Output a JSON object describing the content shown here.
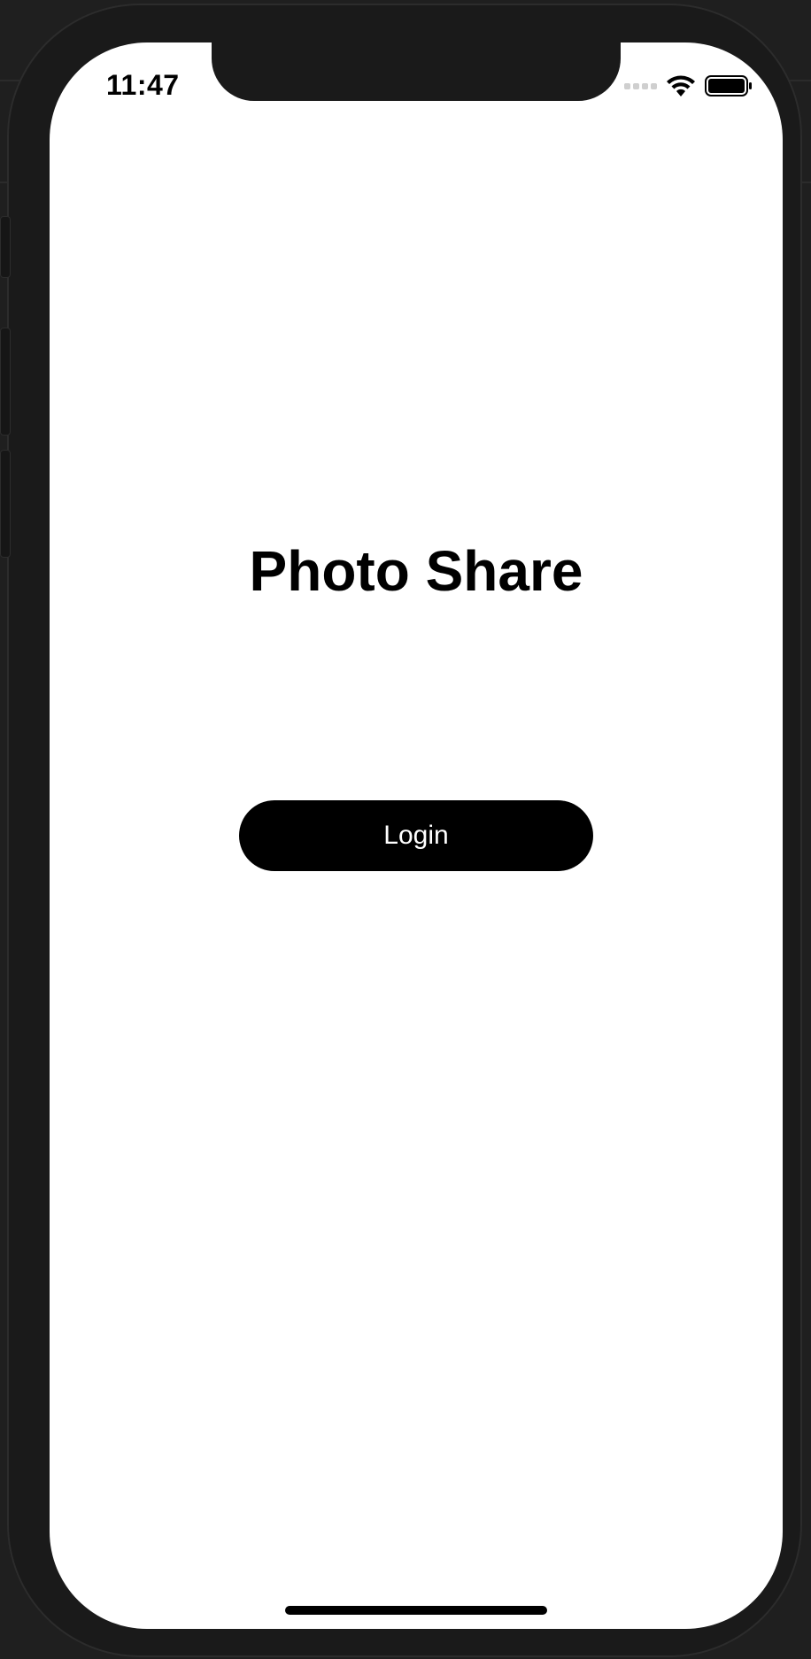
{
  "status_bar": {
    "time": "11:47",
    "signal_icon": "cellular-signal-icon",
    "wifi_icon": "wifi-icon",
    "battery_icon": "battery-icon"
  },
  "app": {
    "title": "Photo Share",
    "login_label": "Login"
  },
  "colors": {
    "button_bg": "#000000",
    "button_text": "#ffffff",
    "screen_bg": "#ffffff",
    "device_frame": "#1a1a1a"
  }
}
